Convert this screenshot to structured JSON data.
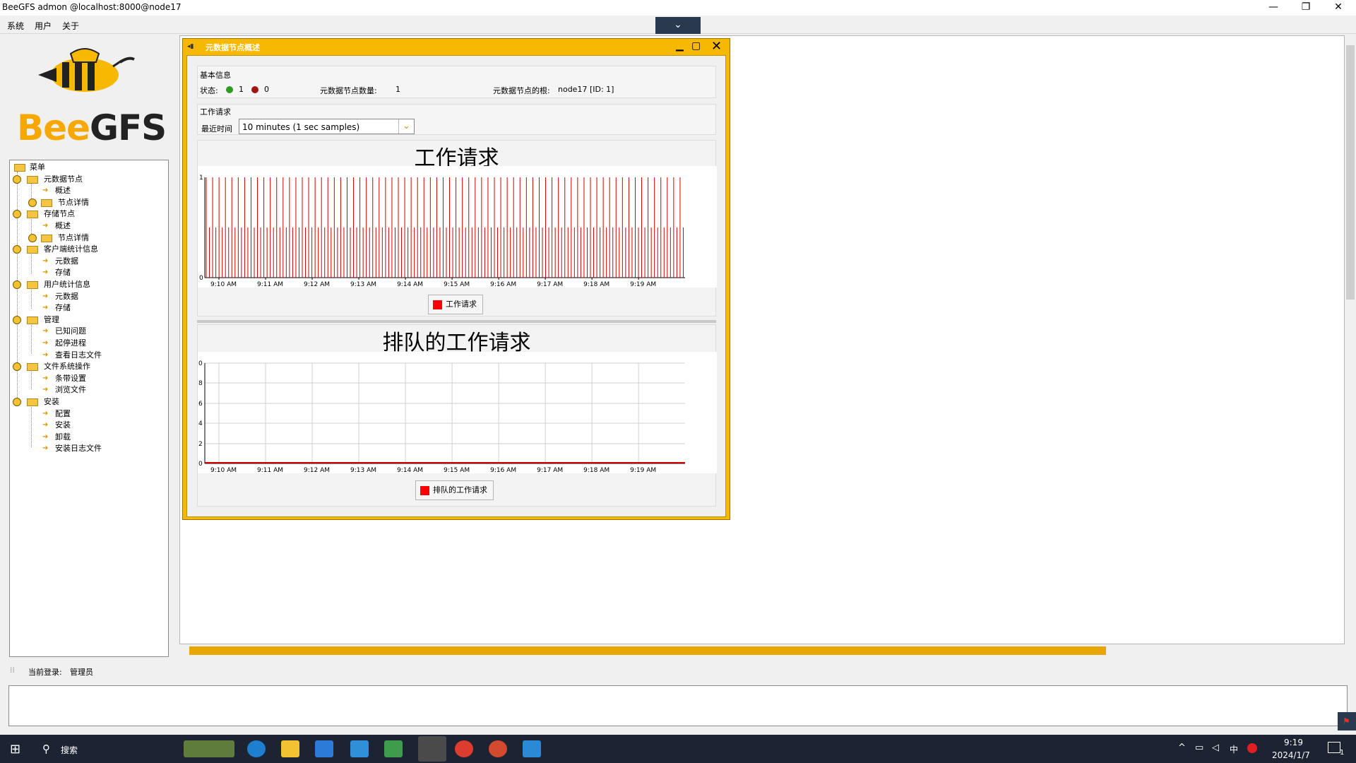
{
  "window": {
    "title": "BeeGFS admon @localhost:8000@node17",
    "minimize": "—",
    "restore": "❐",
    "close": "✕"
  },
  "menubar": {
    "items": [
      "系统",
      "用户",
      "关于"
    ],
    "toggle_icon": "chevron-down"
  },
  "logo": {
    "text": "BeeGFS"
  },
  "tree": {
    "items": [
      {
        "label": "菜单",
        "level": 0
      },
      {
        "label": "元数据节点",
        "level": 1
      },
      {
        "label": "概述",
        "level": 2
      },
      {
        "label": "节点详情",
        "level": 2
      },
      {
        "label": "存储节点",
        "level": 1
      },
      {
        "label": "概述",
        "level": 2
      },
      {
        "label": "节点详情",
        "level": 2
      },
      {
        "label": "客户端统计信息",
        "level": 1
      },
      {
        "label": "元数据",
        "level": 2
      },
      {
        "label": "存储",
        "level": 2
      },
      {
        "label": "用户统计信息",
        "level": 1
      },
      {
        "label": "元数据",
        "level": 2
      },
      {
        "label": "存储",
        "level": 2
      },
      {
        "label": "管理",
        "level": 1
      },
      {
        "label": "已知问题",
        "level": 2
      },
      {
        "label": "起停进程",
        "level": 2
      },
      {
        "label": "查看日志文件",
        "level": 2
      },
      {
        "label": "文件系统操作",
        "level": 1
      },
      {
        "label": "条带设置",
        "level": 2
      },
      {
        "label": "浏览文件",
        "level": 2
      },
      {
        "label": "安装",
        "level": 1
      },
      {
        "label": "配置",
        "level": 2
      },
      {
        "label": "安装",
        "level": 2
      },
      {
        "label": "卸载",
        "level": 2
      },
      {
        "label": "安装日志文件",
        "level": 2
      }
    ]
  },
  "internal_window": {
    "title": "元数据节点概述",
    "basic_info": {
      "section_label": "基本信息",
      "status_label": "状态:",
      "status_green_count": "1",
      "status_red_count": "0",
      "node_count_label": "元数据节点数量:",
      "node_count": "1",
      "root_label": "元数据节点的根:",
      "root_value": "node17 [ID: 1]"
    },
    "work_requests": {
      "section_label": "工作请求",
      "recent_label": "最近时间",
      "select_value": "10 minutes (1 sec samples)"
    },
    "chart1_title": "工作请求",
    "chart1_legend": "工作请求",
    "chart2_title": "排队的工作请求",
    "chart2_legend": "排队的工作请求"
  },
  "chart_data": [
    {
      "type": "bar",
      "title": "工作请求",
      "xlabel": "",
      "ylabel": "",
      "x_ticks": [
        "9:10 AM",
        "9:11 AM",
        "9:12 AM",
        "9:13 AM",
        "9:14 AM",
        "9:15 AM",
        "9:16 AM",
        "9:17 AM",
        "9:18 AM",
        "9:19 AM"
      ],
      "y_ticks": [
        "0",
        "1"
      ],
      "ylim": [
        0,
        1
      ],
      "series": [
        {
          "name": "工作请求",
          "color": "#d00000",
          "pattern": "periodic spikes between 0 and 1"
        }
      ]
    },
    {
      "type": "line",
      "title": "排队的工作请求",
      "xlabel": "",
      "ylabel": "",
      "x_ticks": [
        "9:10 AM",
        "9:11 AM",
        "9:12 AM",
        "9:13 AM",
        "9:14 AM",
        "9:15 AM",
        "9:16 AM",
        "9:17 AM",
        "9:18 AM",
        "9:19 AM"
      ],
      "y_ticks": [
        "0",
        "2",
        "4",
        "6",
        "8",
        "0"
      ],
      "series": [
        {
          "name": "排队的工作请求",
          "color": "#d00000",
          "values_constant": 0
        }
      ]
    }
  ],
  "statusbar": {
    "login_label": "当前登录:",
    "login_user": "管理员"
  },
  "taskbar": {
    "search_label": "搜索",
    "time": "9:19",
    "date": "2024/1/7",
    "ime": "中",
    "notification_count": "1"
  },
  "colors": {
    "accent": "#f6b800",
    "chart_line": "#d00000",
    "taskbar": "#1c2433"
  }
}
